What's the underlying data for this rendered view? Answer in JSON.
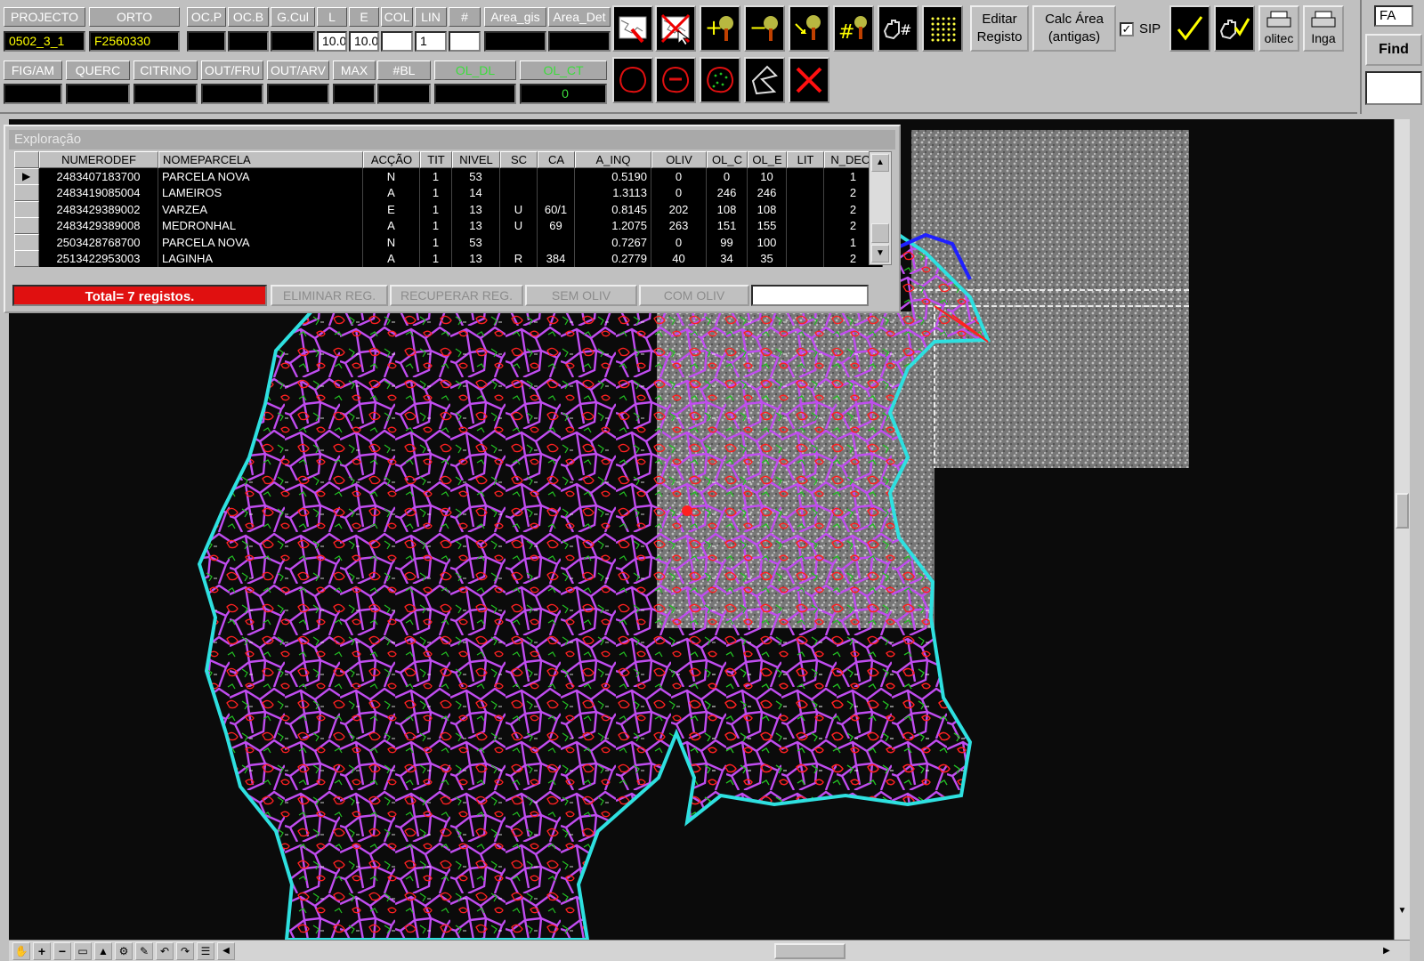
{
  "toolbar": {
    "row1_headers": [
      "PROJECTO",
      "ORTO",
      "OC.P",
      "OC.B",
      "G.Cul",
      "L",
      "E",
      "COL",
      "LIN",
      "#",
      "Area_gis",
      "Area_Det"
    ],
    "row1_values": [
      "0502_3_1",
      "F2560330",
      "",
      "",
      "",
      "10.0",
      "10.0",
      "",
      "1",
      "",
      "",
      ""
    ],
    "row2_headers": [
      "FIG/AM",
      "QUERC",
      "CITRINO",
      "OUT/FRU",
      "OUT/ARV",
      "MAX",
      "#BL",
      "OL_DL",
      "OL_CT"
    ],
    "row2_values": [
      "",
      "",
      "",
      "",
      "",
      "",
      "",
      "",
      "0"
    ],
    "edit_label_1": "Editar",
    "edit_label_2": "Registo",
    "calc_label_1": "Calc Área",
    "calc_label_2": "(antigas)",
    "sip_label": "SIP",
    "sip_checked": true,
    "print1_label": "olitec",
    "print2_label": "Inga"
  },
  "side": {
    "fa_label": "FA",
    "find_label": "Find"
  },
  "panel": {
    "title": "Exploração",
    "columns": [
      "NUMERODEF",
      "NOMEPARCELA",
      "ACÇÃO",
      "TIT",
      "NIVEL",
      "SC",
      "CA",
      "A_INQ",
      "OLIV",
      "OL_C",
      "OL_E",
      "LIT",
      "N_DECL"
    ],
    "rows": [
      [
        "2483407183700",
        "PARCELA NOVA",
        "N",
        "1",
        "53",
        "",
        "",
        "0.5190",
        "0",
        "0",
        "10",
        "",
        "1"
      ],
      [
        "2483419085004",
        "LAMEIROS",
        "A",
        "1",
        "14",
        "",
        "",
        "1.3113",
        "0",
        "246",
        "246",
        "",
        "2"
      ],
      [
        "2483429389002",
        "VARZEA",
        "E",
        "1",
        "13",
        "U",
        "60/1",
        "0.8145",
        "202",
        "108",
        "108",
        "",
        "2"
      ],
      [
        "2483429389008",
        "MEDRONHAL",
        "A",
        "1",
        "13",
        "U",
        "69",
        "1.2075",
        "263",
        "151",
        "155",
        "",
        "2"
      ],
      [
        "2503428768700",
        "PARCELA NOVA",
        "N",
        "1",
        "53",
        "",
        "",
        "0.7267",
        "0",
        "99",
        "100",
        "",
        "1"
      ],
      [
        "2513422953003",
        "LAGINHA",
        "A",
        "1",
        "13",
        "R",
        "384",
        "0.2779",
        "40",
        "34",
        "35",
        "",
        "2"
      ]
    ],
    "total_label": "Total= 7 registos.",
    "btn_delete": "ELIMINAR REG.",
    "btn_recover": "RECUPERAR REG.",
    "btn_sem_oliv": "SEM OLIV",
    "btn_com_oliv": "COM OLIV"
  },
  "colors": {
    "parcel_outline": "#c04cf0",
    "boundary": "#2ee0e0",
    "olive": "#ff2020",
    "green": "#22c022",
    "total_bg": "#e01010"
  }
}
